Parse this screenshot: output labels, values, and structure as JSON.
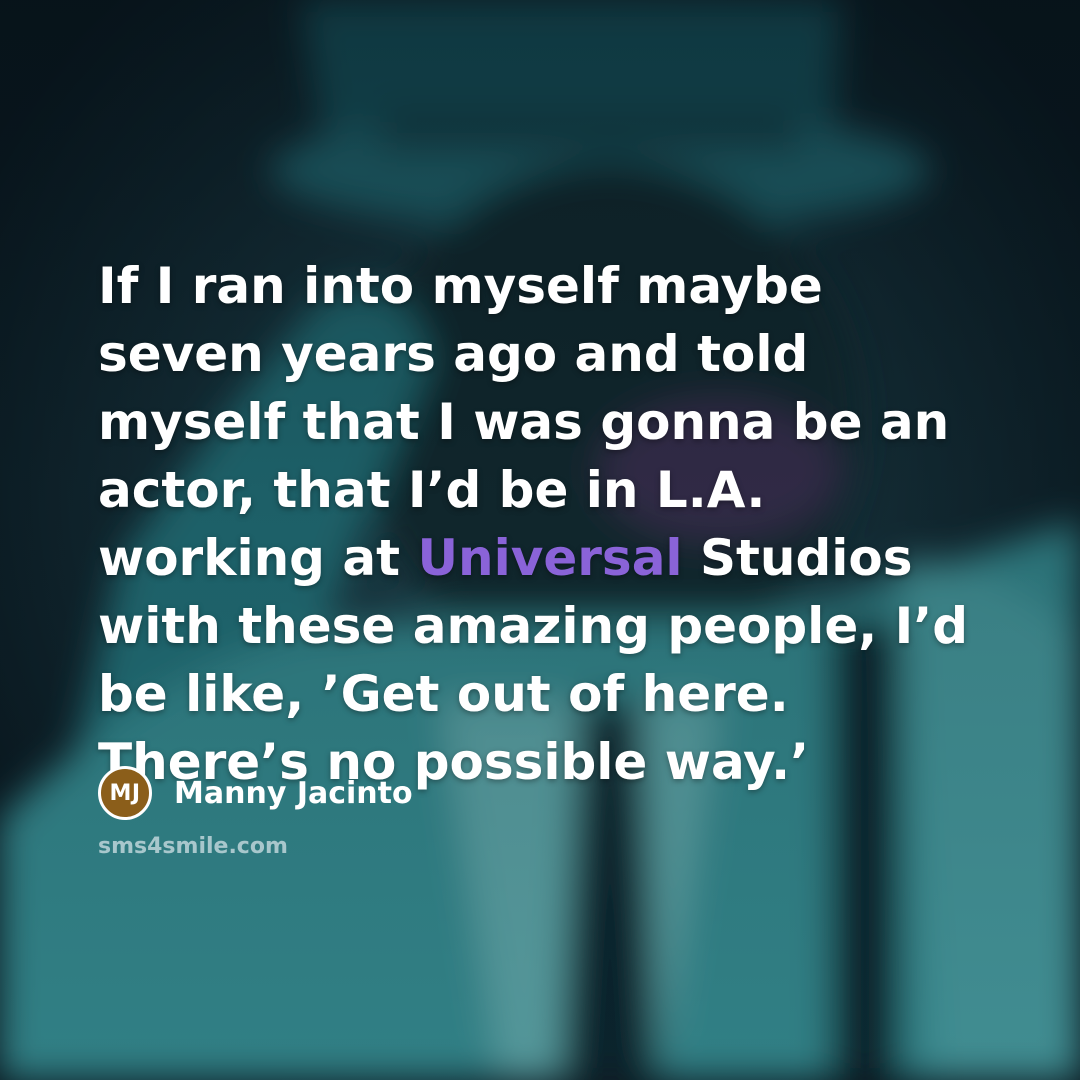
{
  "quote": {
    "before_highlight": "If I ran into myself maybe seven years ago and told myself that I was gonna be an actor, that I’d be in L.A. working at ",
    "highlight": "Universal",
    "after_highlight": " Studios with these amazing people, I’d be like, ’Get out of here. There’s no possible way.’"
  },
  "author": {
    "initials": "MJ",
    "name": "Manny Jacinto"
  },
  "site": "sms4smile.com",
  "colors": {
    "highlight": "#8a63d8",
    "avatar_bg": "#8b5e1a",
    "text": "#ffffff"
  }
}
